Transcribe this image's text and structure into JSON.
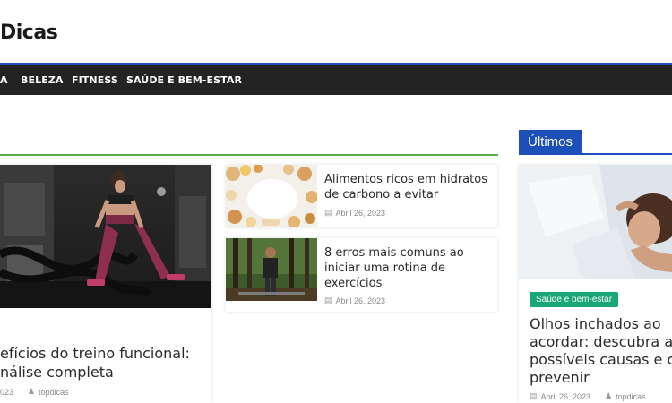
{
  "site": {
    "logo_text": "Dicas"
  },
  "nav": {
    "items": [
      {
        "label": "A"
      },
      {
        "label": "BELEZA"
      },
      {
        "label": "FITNESS"
      },
      {
        "label": "SAÚDE E BEM-ESTAR"
      }
    ]
  },
  "sidebar": {
    "heading": "Últimos"
  },
  "featured": {
    "title_line1": "efícios do treino funcional:",
    "title_line2": "nálise completa",
    "date": "023",
    "author": "topdicas"
  },
  "posts": [
    {
      "title_line1": "Alimentos ricos em hidratos",
      "title_line2": "de carbono a evitar",
      "date": "Abril 26, 2023"
    },
    {
      "title_line1": "8 erros mais comuns ao",
      "title_line2": "iniciar uma rotina de",
      "title_line3": "exercícios",
      "date": "Abril 26, 2023"
    }
  ],
  "latest": {
    "category": "Saúde e bem-estar",
    "title_line1": "Olhos inchados ao",
    "title_line2": "acordar: descubra a",
    "title_line3": "possíveis causas e co",
    "title_line4": "prevenir",
    "date": "Abril 26, 2023",
    "author": "topdicas"
  },
  "icons": {
    "calendar": "calendar-icon",
    "user": "user-icon"
  },
  "colors": {
    "accent_blue": "#1d4fb8",
    "nav_bg": "#232323",
    "section_green": "#5aaa4b",
    "badge_green": "#1aa776"
  }
}
